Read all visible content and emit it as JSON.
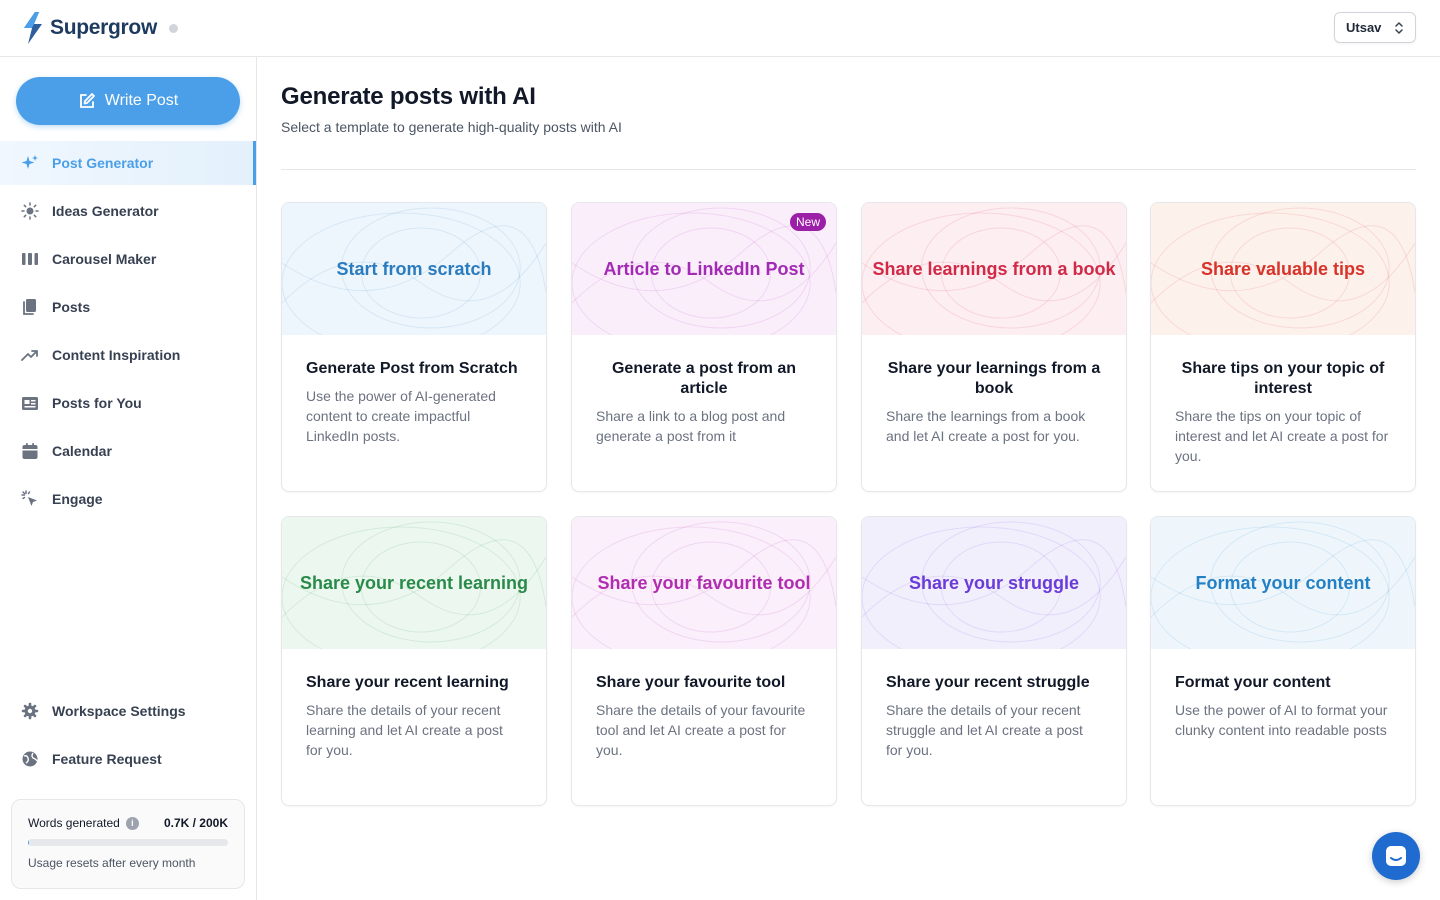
{
  "brand": {
    "name": "Supergrow"
  },
  "user": {
    "name": "Utsav"
  },
  "sidebar": {
    "write_post_label": "Write Post",
    "items": [
      {
        "label": "Post Generator",
        "icon": "sparkles-icon",
        "active": true
      },
      {
        "label": "Ideas Generator",
        "icon": "lightbulb-icon"
      },
      {
        "label": "Carousel Maker",
        "icon": "carousel-icon"
      },
      {
        "label": "Posts",
        "icon": "documents-icon"
      },
      {
        "label": "Content Inspiration",
        "icon": "trending-icon"
      },
      {
        "label": "Posts for You",
        "icon": "newspaper-icon"
      },
      {
        "label": "Calendar",
        "icon": "calendar-icon"
      },
      {
        "label": "Engage",
        "icon": "cursor-click-icon"
      }
    ],
    "bottom_items": [
      {
        "label": "Workspace Settings",
        "icon": "gear-icon"
      },
      {
        "label": "Feature Request",
        "icon": "globe-icon"
      }
    ],
    "usage": {
      "label": "Words generated",
      "count": "0.7K / 200K",
      "fraction": 0.0035,
      "note": "Usage resets after every month"
    }
  },
  "main": {
    "title": "Generate posts with AI",
    "subtitle": "Select a template to generate high-quality posts with AI",
    "cards": [
      {
        "banner": "Start from scratch",
        "title": "Generate Post from Scratch",
        "desc": "Use the power of AI-generated content to create impactful LinkedIn posts.",
        "color": "#2b7bbf",
        "bg": "#eef6fd"
      },
      {
        "banner": "Article to LinkedIn Post",
        "badge": "New",
        "title": "Generate a post from an article",
        "desc": "Share a link to a blog post and generate a post from it",
        "color": "#a22ab5",
        "bg": "#fbeefb"
      },
      {
        "banner": "Share learnings from a book",
        "title": "Share your learnings from a book",
        "desc": "Share the learnings from a book and let AI create a post for you.",
        "color": "#d12a48",
        "bg": "#fdeef1"
      },
      {
        "banner": "Share valuable tips",
        "title": "Share tips on your topic of interest",
        "desc": "Share the tips on your topic of interest and let AI create a post for you.",
        "color": "#d8332a",
        "bg": "#fdf1ec"
      },
      {
        "banner": "Share your recent learning",
        "title": "Share your recent learning",
        "desc": "Share the details of your recent learning and let AI create a post for you.",
        "color": "#2a8a4a",
        "bg": "#ecf8ef"
      },
      {
        "banner": "Share your favourite tool",
        "title": "Share your favourite tool",
        "desc": "Share the details of your favourite tool and let AI create a post for you.",
        "color": "#b02db0",
        "bg": "#fbeffb"
      },
      {
        "banner": "Share your struggle",
        "title": "Share your recent struggle",
        "desc": "Share the details of your recent struggle and let AI create a post for you.",
        "color": "#6a3bd8",
        "bg": "#f2effd"
      },
      {
        "banner": "Format your content",
        "title": "Format your content",
        "desc": "Use the power of AI to format your clunky content into readable posts",
        "color": "#2480c4",
        "bg": "#eef6fc"
      }
    ]
  }
}
